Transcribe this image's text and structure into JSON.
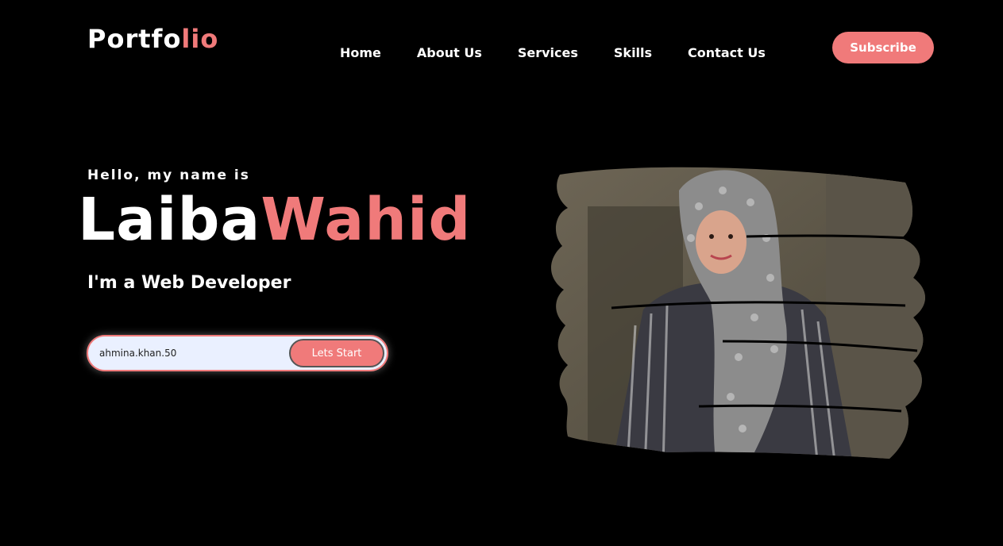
{
  "header": {
    "logo_main": "Portfo",
    "logo_accent": "lio",
    "nav": [
      {
        "label": "Home"
      },
      {
        "label": "About Us"
      },
      {
        "label": "Services"
      },
      {
        "label": "Skills"
      },
      {
        "label": "Contact Us"
      }
    ],
    "subscribe_label": "Subscribe"
  },
  "hero": {
    "greeting": "Hello, my name is",
    "first_name": "Laiba",
    "last_name": "Wahid",
    "role": "I'm a Web Developer",
    "email_value": "ahmina.khan.50",
    "start_label": "Lets Start"
  },
  "colors": {
    "background": "#000000",
    "accent": "#f07a7a",
    "text": "#ffffff",
    "input_bg": "#eaf0ff"
  },
  "icons": {
    "photo": "profile-photo-brush"
  }
}
